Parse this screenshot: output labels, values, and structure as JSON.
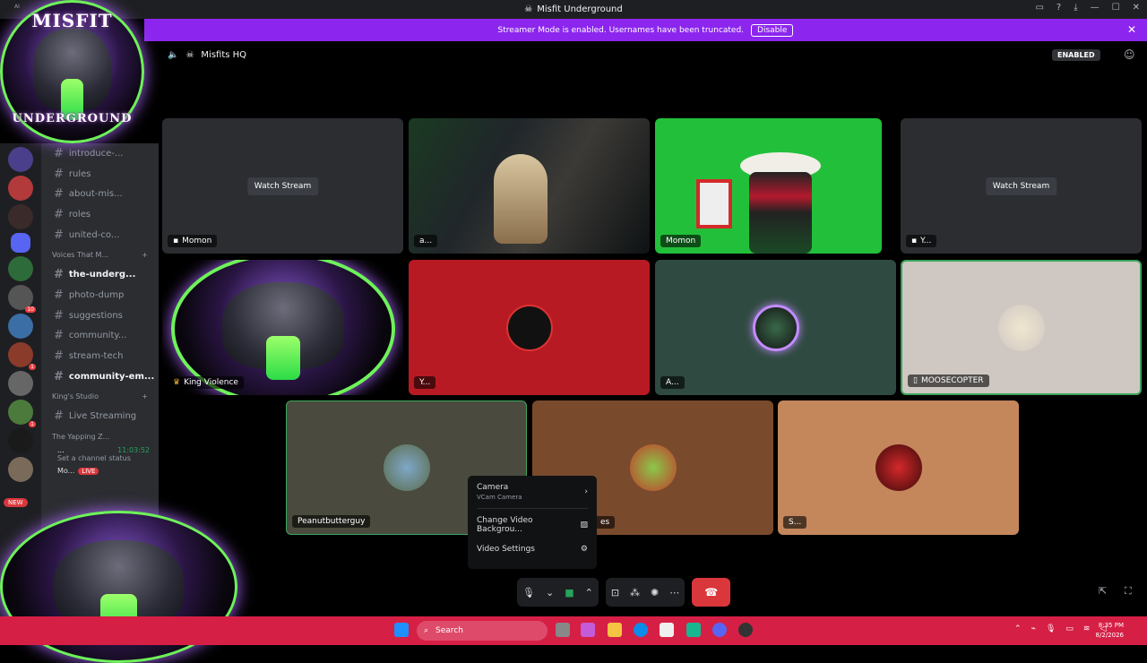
{
  "window": {
    "title": "Misfit Underground",
    "brand_color": "#5865f2",
    "banner_text": "Streamer Mode is enabled. Usernames have been truncated.",
    "banner_button": "Disable",
    "banner_color": "#8c26ee",
    "corner_label": "AI"
  },
  "overlay": {
    "logo_top_text": "MISFIT",
    "logo_bottom_text": "UNDERGROUND"
  },
  "sidebar": {
    "channels": [
      {
        "icon": "pencil-icon",
        "label": "introduce-..."
      },
      {
        "icon": "scroll-icon",
        "label": "rules"
      },
      {
        "icon": "lightning-icon",
        "label": "about-mis..."
      },
      {
        "icon": "tag-icon",
        "label": "roles"
      },
      {
        "icon": "planet-icon",
        "label": "united-co..."
      }
    ],
    "category1": "Voices That M...",
    "channels2": [
      {
        "icon": "speech-icon",
        "label": "the-underg...",
        "bold": true
      },
      {
        "icon": "microphone-icon",
        "label": "photo-dump"
      },
      {
        "icon": "note-icon",
        "label": "suggestions"
      },
      {
        "icon": "board-icon",
        "label": "community..."
      },
      {
        "icon": "",
        "label": "stream-tech"
      },
      {
        "icon": "",
        "label": "community-em...",
        "bold": true
      }
    ],
    "category2": "King's Studio",
    "live_channel": "Live Streaming",
    "voice_channel": "The Yapping Z...",
    "voice_user_name": "...",
    "voice_timer": "11:03:52",
    "voice_status": "Set a channel status",
    "live_user": "Mo...",
    "live_badge": "LIVE",
    "new_badge": "NEW",
    "guild_badges": [
      "10",
      "1",
      "1"
    ]
  },
  "header": {
    "server_name": "Misfits HQ",
    "enabled_label": "ENABLED"
  },
  "tiles": [
    {
      "name": "Momon",
      "watch": "Watch Stream",
      "kind": "stream"
    },
    {
      "name": "a...",
      "kind": "camera"
    },
    {
      "name": "Momon",
      "kind": "camera"
    },
    {
      "name": "Y...",
      "watch": "Watch Stream",
      "kind": "stream"
    },
    {
      "name": "King Violence",
      "kind": "avatar"
    },
    {
      "name": "Y...",
      "kind": "avatar"
    },
    {
      "name": "A...",
      "kind": "avatar"
    },
    {
      "name": "MOOSECOPTER",
      "kind": "avatar"
    },
    {
      "name": "Peanutbutterguy",
      "kind": "avatar"
    },
    {
      "name": "es",
      "kind": "avatar"
    },
    {
      "name": "S...",
      "kind": "avatar"
    }
  ],
  "context_menu": {
    "camera_label": "Camera",
    "camera_sub": "VCam Camera",
    "change_bg": "Change Video Backgrou...",
    "video_settings": "Video Settings"
  },
  "taskbar": {
    "search": "Search",
    "time": "8:35 PM",
    "date": "8/2/2026"
  }
}
